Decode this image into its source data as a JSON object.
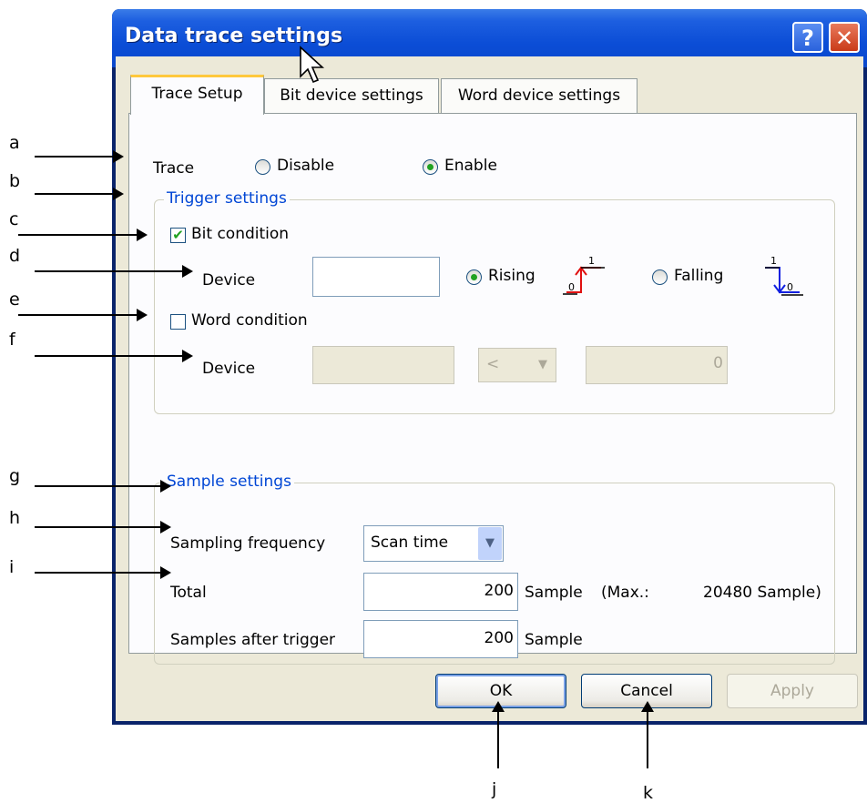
{
  "dialog": {
    "title": "Data trace settings",
    "help_label": "?",
    "close_label": "✕"
  },
  "tabs": [
    {
      "label": "Trace Setup",
      "active": true
    },
    {
      "label": "Bit device settings",
      "active": false
    },
    {
      "label": "Word device settings",
      "active": false
    }
  ],
  "trace": {
    "label": "Trace",
    "disable_label": "Disable",
    "enable_label": "Enable",
    "selected": "Enable"
  },
  "trigger": {
    "legend": "Trigger settings",
    "bit_condition_label": "Bit condition",
    "bit_condition_checked": true,
    "bit_device_label": "Device",
    "bit_device_value": "",
    "rising_label": "Rising",
    "falling_label": "Falling",
    "edge_selected": "Rising",
    "rising_hi": "1",
    "rising_lo": "0",
    "falling_hi": "1",
    "falling_lo": "0",
    "word_condition_label": "Word condition",
    "word_condition_checked": false,
    "word_device_label": "Device",
    "word_device_value": "",
    "operator_value": "<",
    "compare_value": "0"
  },
  "sample": {
    "legend": "Sample settings",
    "frequency_label": "Sampling frequency",
    "frequency_value": "Scan time",
    "total_label": "Total",
    "total_value": "200",
    "total_unit": "Sample",
    "max_text": "(Max.:",
    "max_value": "20480 Sample)",
    "after_trigger_label": "Samples after trigger",
    "after_trigger_value": "200",
    "after_trigger_unit": "Sample"
  },
  "buttons": {
    "ok": "OK",
    "cancel": "Cancel",
    "apply": "Apply"
  },
  "annotations": [
    "a",
    "b",
    "c",
    "d",
    "e",
    "f",
    "g",
    "h",
    "i",
    "j",
    "k"
  ],
  "colors": {
    "titlebar": "#0b4dd6",
    "legend_text": "#0046d5",
    "radio_dot": "#21a121",
    "rising_icon": "#e01010",
    "falling_icon": "#1020e0",
    "tab_highlight": "#ffc83c"
  }
}
